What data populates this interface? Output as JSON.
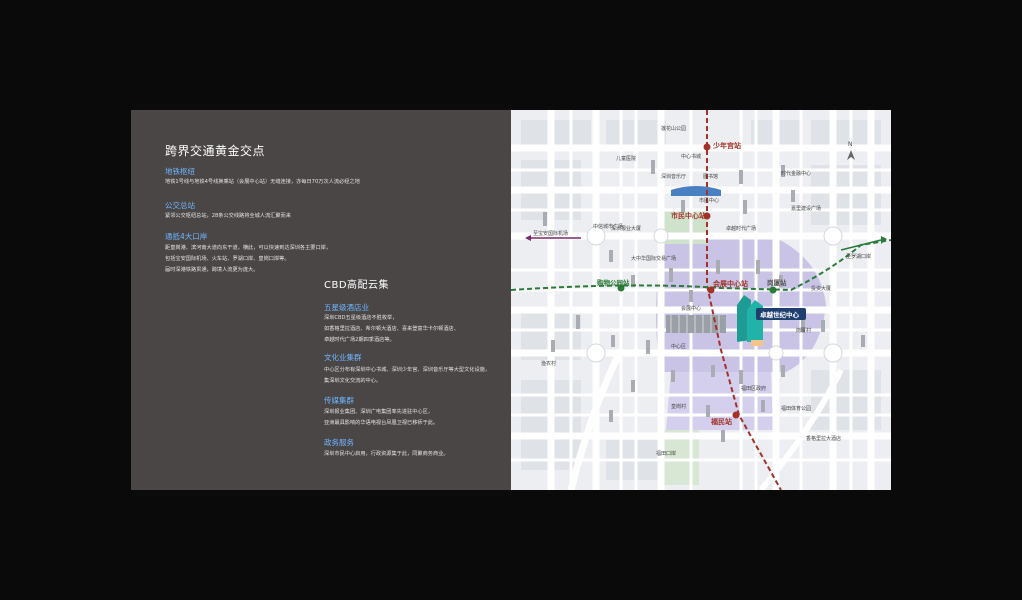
{
  "left_panel": {
    "heading1": "跨界交通黄金交点",
    "transport": [
      {
        "title": "地铁枢纽",
        "lines": [
          "地铁1号线与地铁4号线换乘站（会展中心站）无缝连接，亦每日70万次人流必经之地"
        ]
      },
      {
        "title": "公交总站",
        "lines": [
          "紧邻公交枢纽总站，28条公交线路将全城人流汇聚而来"
        ]
      },
      {
        "title": "通抵4大口岸",
        "lines": [
          "距皇岗港、滨河南大道向东干道，横此，可以快速到达深圳各主要口岸，",
          "包括宝安国际机场、火车站、罗湖口岸、皇岗口岸等。",
          "届时深港铁路贯通，跨境人流更为庞大。"
        ]
      }
    ],
    "heading2": "CBD高配云集",
    "cbd": [
      {
        "title": "五星级酒店业",
        "lines": [
          "深圳CBD五星级酒店不胜枚举，",
          "如香格里拉酒店、希尔顿大酒店、喜来登富华卡尔顿酒店、",
          "卓越时代广场2期四季酒店等。"
        ]
      },
      {
        "title": "文化业集群",
        "lines": [
          "中心区分布有深圳中心书城、深圳少年宫、深圳音乐厅等大型文化设施，",
          "集深圳文化交流的中心。"
        ]
      },
      {
        "title": "传媒集群",
        "lines": [
          "深圳报业集团、深圳广电集团率先进驻中心区，",
          "亚洲最具影响的华语电视台凤凰卫视已移师于此。"
        ]
      },
      {
        "title": "政务服务",
        "lines": [
          "深圳市民中心启用，行政资源集于此，同聚商务商业。"
        ]
      }
    ]
  },
  "map": {
    "compass": "N",
    "stations_red": [
      "少年宫站",
      "市民中心站",
      "会展中心站",
      "福民站"
    ],
    "stations_green": [
      "购物公园站",
      "岗厦站"
    ],
    "project_label": "卓越世纪中心",
    "district_labels": [
      "中心书城",
      "深圳音乐厅",
      "图书馆",
      "市民中心",
      "中心区",
      "大中华国际交易广场",
      "会展中心",
      "卓越时代广场",
      "深圳报业大厦",
      "岗厦村",
      "渔农村",
      "皇岗村",
      "福田区政府",
      "福田口岸",
      "莲花山公园",
      "儿童医院",
      "中信城市广场",
      "福田体育公园",
      "香格里拉大酒店",
      "时代金融中心",
      "嘉里建设广场",
      "投资大厦"
    ],
    "arrow_labels": [
      "至宝安国际机场",
      "至罗湖口岸"
    ],
    "colors": {
      "rail_red": "#a3312a",
      "rail_green": "#2b7a39",
      "district_purple": "#c9c4e6",
      "accent_blue": "#6fb6ff"
    }
  }
}
